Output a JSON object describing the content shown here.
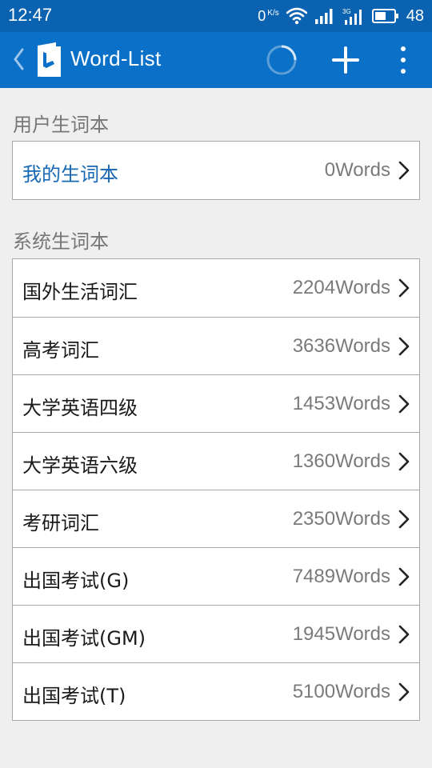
{
  "status_bar": {
    "time": "12:47",
    "net_speed": "0",
    "net_unit": "K/s",
    "battery": "48"
  },
  "app_bar": {
    "title": "Word-List",
    "icons": {
      "back": "back-icon",
      "logo": "bing-dictionary-logo",
      "loading": "loading-spinner-icon",
      "add": "plus-icon",
      "more": "more-vertical-icon"
    }
  },
  "user_section": {
    "title": "用户生词本",
    "items": [
      {
        "label": "我的生词本",
        "count": "0Words"
      }
    ]
  },
  "system_section": {
    "title": "系统生词本",
    "items": [
      {
        "label": "国外生活词汇",
        "count": "2204Words"
      },
      {
        "label": "高考词汇",
        "count": "3636Words"
      },
      {
        "label": "大学英语四级",
        "count": "1453Words"
      },
      {
        "label": "大学英语六级",
        "count": "1360Words"
      },
      {
        "label": "考研词汇",
        "count": "2350Words"
      },
      {
        "label": "出国考试(G)",
        "count": "7489Words"
      },
      {
        "label": "出国考试(GM)",
        "count": "1945Words"
      },
      {
        "label": "出国考试(T)",
        "count": "5100Words"
      }
    ]
  },
  "colors": {
    "status_bar": "#0a62b0",
    "app_bar": "#0b70c7",
    "background": "#efefef",
    "highlight_text": "#1668b4"
  }
}
